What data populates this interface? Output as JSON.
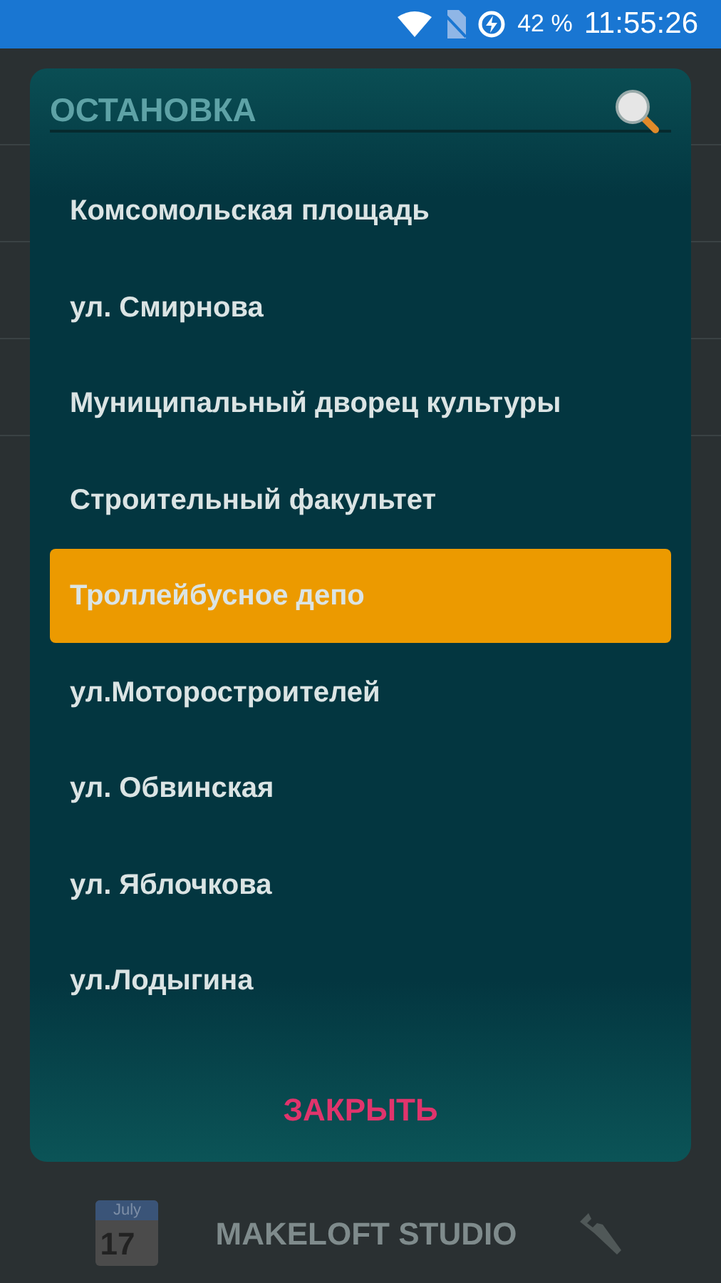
{
  "status_bar": {
    "battery": "42 %",
    "time": "11:55:26"
  },
  "dialog": {
    "title": "ОСТАНОВКА",
    "items": [
      {
        "label": "Комсомольская площадь",
        "selected": false
      },
      {
        "label": "ул. Смирнова",
        "selected": false
      },
      {
        "label": "Муниципальный дворец культуры",
        "selected": false
      },
      {
        "label": "Строительный факультет",
        "selected": false
      },
      {
        "label": "Троллейбусное депо",
        "selected": true
      },
      {
        "label": "ул.Моторостроителей",
        "selected": false
      },
      {
        "label": "ул. Обвинская",
        "selected": false
      },
      {
        "label": "ул. Яблочкова",
        "selected": false
      },
      {
        "label": "ул.Лодыгина",
        "selected": false
      }
    ],
    "close_button": "ЗАКРЫТЬ"
  },
  "bottom_bar": {
    "calendar_month": "July",
    "calendar_day": "17",
    "brand": "MAKELOFT STUDIO"
  }
}
